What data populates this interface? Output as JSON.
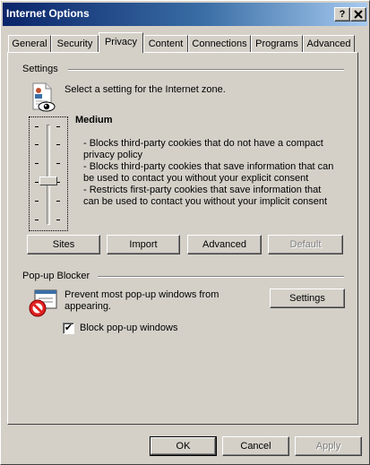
{
  "window": {
    "title": "Internet Options",
    "help_button": "?",
    "close_button": "✕"
  },
  "tabs": [
    {
      "label": "General"
    },
    {
      "label": "Security"
    },
    {
      "label": "Privacy",
      "active": true
    },
    {
      "label": "Content"
    },
    {
      "label": "Connections"
    },
    {
      "label": "Programs"
    },
    {
      "label": "Advanced"
    }
  ],
  "settings": {
    "group_label": "Settings",
    "intro": "Select a setting for the Internet zone.",
    "level_title": "Medium",
    "descriptions": [
      "- Blocks third-party cookies that do not have a compact",
      "privacy policy",
      "- Blocks third-party cookies that save information that can",
      "be used to contact you without your explicit consent",
      "- Restricts first-party cookies that save information that",
      "can be used to contact you without your implicit consent"
    ],
    "slider_level": "3 of 6",
    "buttons": {
      "sites": "Sites",
      "import": "Import",
      "advanced": "Advanced",
      "default": "Default"
    },
    "icon": "privacy-report-eye-icon"
  },
  "popup": {
    "group_label": "Pop-up Blocker",
    "description_line1": "Prevent most pop-up windows from",
    "description_line2": "appearing.",
    "settings_button": "Settings",
    "checkbox_label": "Block pop-up windows",
    "checkbox_checked": true,
    "checkbox_mark": "✔",
    "icon": "popup-blocker-icon"
  },
  "footer": {
    "ok": "OK",
    "cancel": "Cancel",
    "apply": "Apply"
  },
  "colors": {
    "titlebar_start": "#0a246a",
    "titlebar_end": "#a6caf0",
    "face": "#d4d0c8"
  }
}
